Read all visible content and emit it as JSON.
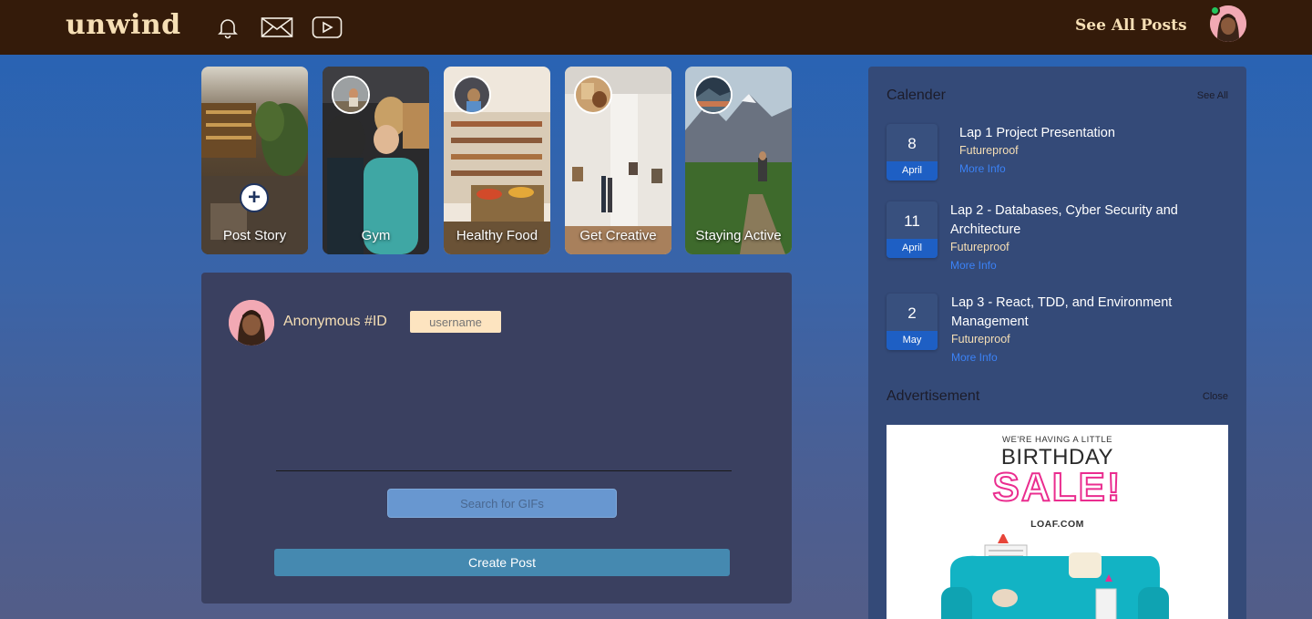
{
  "header": {
    "logo": "unwind",
    "see_all_posts": "See All Posts"
  },
  "icons": {
    "notifications": "bell-icon",
    "messages": "envelope-icon",
    "videos": "video-play-icon"
  },
  "stories": [
    {
      "label": "Post Story"
    },
    {
      "label": "Gym"
    },
    {
      "label": "Healthy Food"
    },
    {
      "label": "Get Creative"
    },
    {
      "label": "Staying Active"
    }
  ],
  "post_form": {
    "user_name": "Anonymous #ID",
    "username_placeholder": "username",
    "gif_placeholder": "Search for GIFs",
    "create_post": "Create Post"
  },
  "calendar": {
    "title": "Calender",
    "see_all": "See All",
    "events": [
      {
        "day": "8",
        "month": "April",
        "title": "Lap 1 Project Presentation",
        "org": "Futureproof",
        "more": "More Info"
      },
      {
        "day": "11",
        "month": "April",
        "title": "Lap 2 - Databases, Cyber Security and Architecture",
        "org": "Futureproof",
        "more": "More Info"
      },
      {
        "day": "2",
        "month": "May",
        "title": "Lap 3 - React, TDD, and Environment Management",
        "org": "Futureproof",
        "more": "More Info"
      }
    ]
  },
  "advertisement": {
    "title": "Advertisement",
    "close": "Close",
    "line1": "WE'RE HAVING A LITTLE",
    "line2": "BIRTHDAY",
    "line3": "SALE!",
    "line4": "LOAF.COM"
  },
  "colors": {
    "topbar": "#341b0a",
    "logo": "#f6dfb5",
    "accent": "#1e5fc4",
    "sale_pink": "#ea2d8f"
  }
}
